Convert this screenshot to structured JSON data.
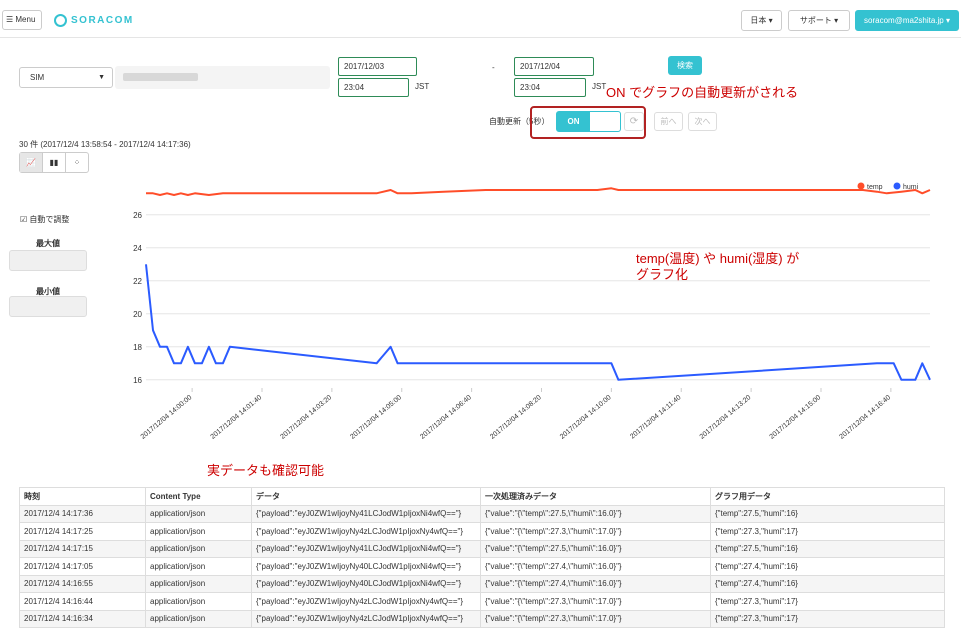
{
  "header": {
    "menu_label": "☰ Menu",
    "logo_text": "SORACOM",
    "language_label": "日本 ▾",
    "support_label": "サポート ▾",
    "account_label": "soracom@ma2shita.jp ▾"
  },
  "query": {
    "sim_select_value": "SIM",
    "start_date": "2017/12/03",
    "start_time": "23:04",
    "start_tz": "JST",
    "range_separator": "-",
    "end_date": "2017/12/04",
    "end_time": "23:04",
    "end_tz": "JST",
    "search_label": "検索"
  },
  "autorefresh": {
    "label": "自動更新（5秒）",
    "toggle_on": "ON",
    "prev_label": "前へ",
    "next_label": "次へ"
  },
  "summary": {
    "count_text": "30 件 (2017/12/4 13:58:54 - 2017/12/4 14:17:36)"
  },
  "chart_type_buttons": [
    "line",
    "bar",
    "scatter"
  ],
  "side": {
    "auto_adjust_label": "☑ 自動で調整",
    "max_label": "最大値",
    "min_label": "最小値"
  },
  "annotations": {
    "autorefresh_note": "ON でグラフの自動更新がされる",
    "graph_note_line1": "temp(温度) や humi(湿度) が",
    "graph_note_line2": "グラフ化",
    "table_note": "実データも確認可能"
  },
  "colors": {
    "accent": "#34c2d1",
    "temp": "#ff4d29",
    "humi": "#2b5bff",
    "annotation": "#cc0000"
  },
  "chart_data": {
    "type": "line",
    "legend_position": "top-right",
    "ylim": [
      15.5,
      27.5
    ],
    "yticks": [
      16,
      18,
      20,
      22,
      24,
      26
    ],
    "xticks": [
      "2017/12/04 14:00:00",
      "2017/12/04 14:01:40",
      "2017/12/04 14:03:20",
      "2017/12/04 14:05:00",
      "2017/12/04 14:06:40",
      "2017/12/04 14:08:20",
      "2017/12/04 14:10:00",
      "2017/12/04 14:11:40",
      "2017/12/04 14:13:20",
      "2017/12/04 14:15:00",
      "2017/12/04 14:16:40"
    ],
    "series": [
      {
        "name": "temp",
        "color": "#ff4d29",
        "x": [
          "13:58:54",
          "13:59:04",
          "13:59:14",
          "13:59:24",
          "13:59:34",
          "13:59:44",
          "13:59:54",
          "14:00:04",
          "14:00:24",
          "14:00:44",
          "14:02:00",
          "14:03:00",
          "14:04:24",
          "14:04:44",
          "14:04:54",
          "14:05:14",
          "14:06:00",
          "14:07:00",
          "14:08:30",
          "14:09:40",
          "14:10:00",
          "14:10:10",
          "14:12:00",
          "14:14:00",
          "14:16:00",
          "14:16:20",
          "14:16:34",
          "14:16:55",
          "14:17:15",
          "14:17:25",
          "14:17:36"
        ],
        "values": [
          27.3,
          27.3,
          27.2,
          27.3,
          27.2,
          27.3,
          27.2,
          27.3,
          27.2,
          27.3,
          27.3,
          27.3,
          27.3,
          27.5,
          27.3,
          27.3,
          27.4,
          27.5,
          27.5,
          27.5,
          27.6,
          27.5,
          27.5,
          27.5,
          27.5,
          27.4,
          27.3,
          27.4,
          27.5,
          27.3,
          27.5
        ]
      },
      {
        "name": "humi",
        "color": "#2b5bff",
        "x": [
          "13:58:54",
          "13:59:04",
          "13:59:14",
          "13:59:24",
          "13:59:34",
          "13:59:44",
          "13:59:54",
          "14:00:04",
          "14:00:14",
          "14:00:24",
          "14:00:34",
          "14:00:44",
          "14:00:54",
          "14:04:24",
          "14:04:44",
          "14:04:54",
          "14:10:00",
          "14:10:10",
          "14:16:20",
          "14:16:34",
          "14:16:44",
          "14:16:55",
          "14:17:05",
          "14:17:15",
          "14:17:25",
          "14:17:36"
        ],
        "values": [
          23,
          19,
          18,
          18,
          17,
          17,
          18,
          17,
          17,
          18,
          17,
          17,
          18,
          17,
          18,
          17,
          17,
          16,
          17,
          17,
          17,
          16,
          16,
          16,
          17,
          16
        ]
      }
    ]
  },
  "table": {
    "headers": [
      "時刻",
      "Content Type",
      "データ",
      "一次処理済みデータ",
      "グラフ用データ"
    ],
    "rows": [
      [
        "2017/12/4 14:17:36",
        "application/json",
        "{\"payload\":\"eyJ0ZW1wIjoyNy41LCJodW1pIjoxNi4wfQ==\"}",
        "{\"value\":\"{\\\"temp\\\":27.5,\\\"humi\\\":16.0}\"}",
        "{\"temp\":27.5,\"humi\":16}"
      ],
      [
        "2017/12/4 14:17:25",
        "application/json",
        "{\"payload\":\"eyJ0ZW1wIjoyNy4zLCJodW1pIjoxNy4wfQ==\"}",
        "{\"value\":\"{\\\"temp\\\":27.3,\\\"humi\\\":17.0}\"}",
        "{\"temp\":27.3,\"humi\":17}"
      ],
      [
        "2017/12/4 14:17:15",
        "application/json",
        "{\"payload\":\"eyJ0ZW1wIjoyNy41LCJodW1pIjoxNi4wfQ==\"}",
        "{\"value\":\"{\\\"temp\\\":27.5,\\\"humi\\\":16.0}\"}",
        "{\"temp\":27.5,\"humi\":16}"
      ],
      [
        "2017/12/4 14:17:05",
        "application/json",
        "{\"payload\":\"eyJ0ZW1wIjoyNy40LCJodW1pIjoxNi4wfQ==\"}",
        "{\"value\":\"{\\\"temp\\\":27.4,\\\"humi\\\":16.0}\"}",
        "{\"temp\":27.4,\"humi\":16}"
      ],
      [
        "2017/12/4 14:16:55",
        "application/json",
        "{\"payload\":\"eyJ0ZW1wIjoyNy40LCJodW1pIjoxNi4wfQ==\"}",
        "{\"value\":\"{\\\"temp\\\":27.4,\\\"humi\\\":16.0}\"}",
        "{\"temp\":27.4,\"humi\":16}"
      ],
      [
        "2017/12/4 14:16:44",
        "application/json",
        "{\"payload\":\"eyJ0ZW1wIjoyNy4zLCJodW1pIjoxNy4wfQ==\"}",
        "{\"value\":\"{\\\"temp\\\":27.3,\\\"humi\\\":17.0}\"}",
        "{\"temp\":27.3,\"humi\":17}"
      ],
      [
        "2017/12/4 14:16:34",
        "application/json",
        "{\"payload\":\"eyJ0ZW1wIjoyNy4zLCJodW1pIjoxNy4wfQ==\"}",
        "{\"value\":\"{\\\"temp\\\":27.3,\\\"humi\\\":17.0}\"}",
        "{\"temp\":27.3,\"humi\":17}"
      ]
    ]
  }
}
